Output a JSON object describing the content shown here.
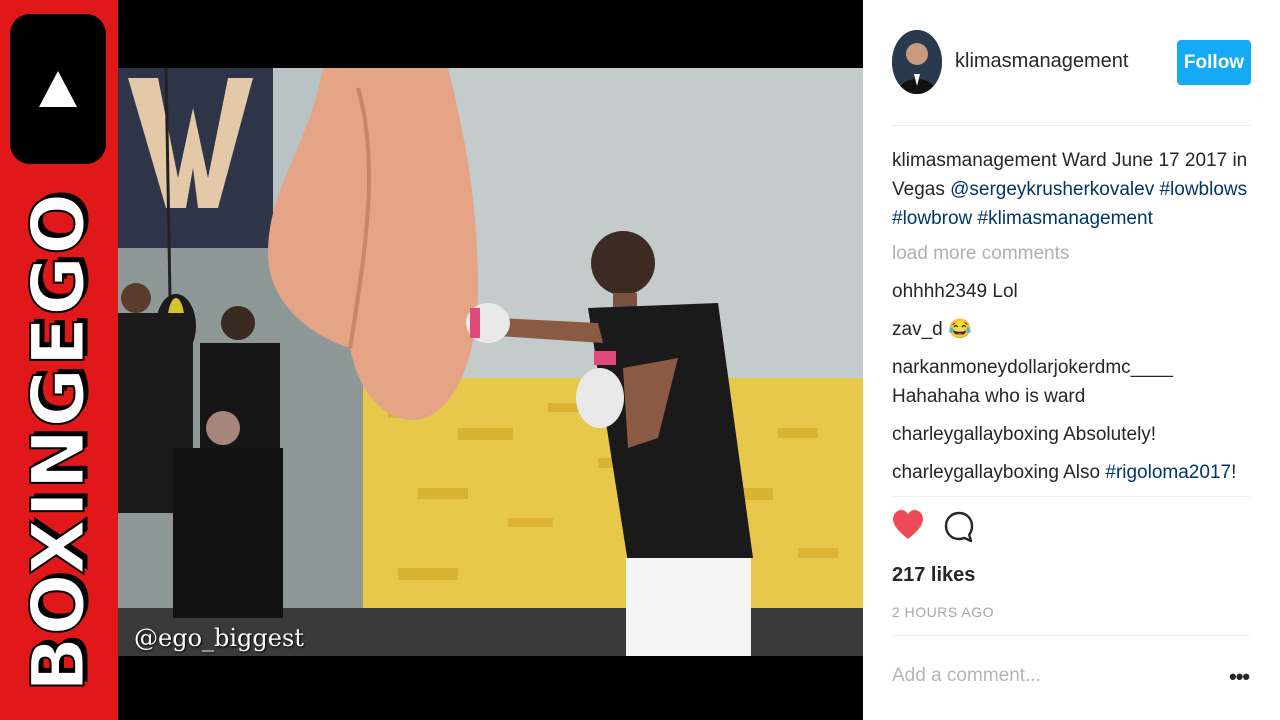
{
  "brand": {
    "channel_name": "BOXINGEGO",
    "logo_icon": "play-triangle-icon"
  },
  "media": {
    "watermark": "@ego_biggest"
  },
  "post": {
    "username": "klimasmanagement",
    "follow_label": "Follow",
    "caption": {
      "user": "klimasmanagement",
      "text": "Ward June 17 2017 in Vegas",
      "mentions": "@sergeykrusherkovalev",
      "tags": "#lowblows #lowbrow #klimasmanagement"
    },
    "load_more": "load more comments",
    "comments": [
      {
        "user": "ohhhh2349",
        "text": "Lol",
        "tag": ""
      },
      {
        "user": "zav_d",
        "text": "😂",
        "tag": ""
      },
      {
        "user": "narkanmoneydollarjokerdmc____",
        "text": "Hahahaha who is ward",
        "tag": ""
      },
      {
        "user": "charleygallayboxing",
        "text": "Absolutely!",
        "tag": ""
      },
      {
        "user": "charleygallayboxing",
        "text": "Also",
        "tag": "#rigoloma2017",
        "after": "!"
      }
    ],
    "likes": "217 likes",
    "timestamp": "2 HOURS AGO",
    "add_comment_placeholder": "Add a comment...",
    "more_options": "•••",
    "colors": {
      "follow_bg": "#14aaf5",
      "heart": "#ed4956",
      "hashtag": "#003569",
      "brand_red": "#e0181a"
    },
    "icons": {
      "like": "heart-icon",
      "comment": "comment-bubble-icon"
    }
  }
}
